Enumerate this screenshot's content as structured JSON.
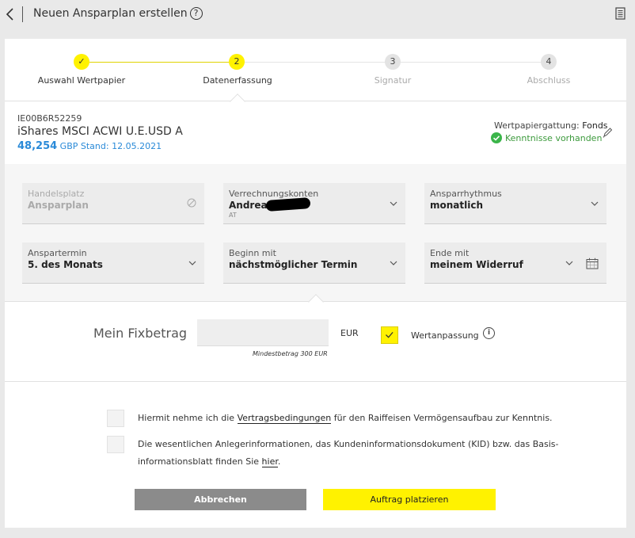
{
  "header": {
    "title": "Neuen Ansparplan erstellen",
    "help": "?"
  },
  "steps": [
    {
      "number": "✓",
      "label": "Auswahl Wertpapier",
      "state": "done"
    },
    {
      "number": "2",
      "label": "Datenerfassung",
      "state": "active"
    },
    {
      "number": "3",
      "label": "Signatur",
      "state": "pending"
    },
    {
      "number": "4",
      "label": "Abschluss",
      "state": "pending"
    }
  ],
  "security": {
    "isin": "IE00B6R52259",
    "name": "iShares MSCI ACWI U.E.USD A",
    "price": "48,254",
    "currency": "GBP",
    "stand": "Stand: 12.05.2021",
    "gattung_label": "Wertpapiergattung:",
    "gattung_value": "Fonds",
    "kenntnisse": "Kenntnisse vorhanden"
  },
  "fields": {
    "handelsplatz": {
      "label": "Handelsplatz",
      "value": "Ansparplan"
    },
    "verrechnungskonten": {
      "label": "Verrechnungskonten",
      "value": "Andreas",
      "sub": "AT"
    },
    "ansparrhythmus": {
      "label": "Ansparrhythmus",
      "value": "monatlich"
    },
    "anspartermin": {
      "label": "Anspartermin",
      "value": "5. des Monats"
    },
    "beginn": {
      "label": "Beginn mit",
      "value": "nächstmöglicher Termin"
    },
    "ende": {
      "label": "Ende mit",
      "value": "meinem Widerruf"
    }
  },
  "fixbetrag": {
    "label": "Mein Fixbetrag",
    "value": "",
    "currency": "EUR",
    "min_note": "Mindestbetrag 300 EUR",
    "wertanpassung_label": "Wertanpassung",
    "wertanpassung_checked": true
  },
  "consent1": {
    "before": "Hiermit nehme ich die ",
    "link": "Vertragsbedingungen",
    "after": " für den Raiffeisen Vermögensaufbau zur Kenntnis."
  },
  "consent2": {
    "line1": "Die wesentlichen Anlegerinformationen, das Kundeninformationsdokument (KID) bzw. das Basis-",
    "line2_before": "informationsblatt finden Sie ",
    "link": "hier",
    "line2_after": "."
  },
  "buttons": {
    "cancel": "Abbrechen",
    "submit": "Auftrag platzieren"
  },
  "colors": {
    "accent": "#fff200",
    "price_blue": "#2a8ad8",
    "success_green": "#3bb54a"
  }
}
